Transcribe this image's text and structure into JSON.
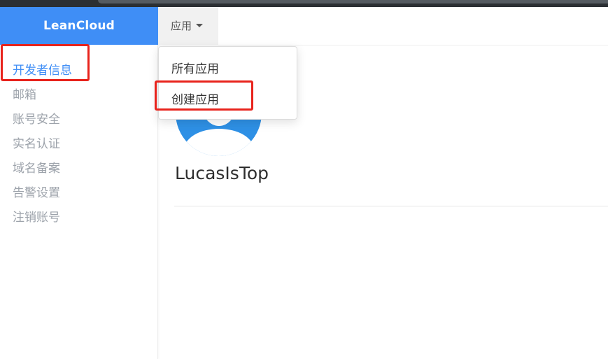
{
  "brand": {
    "name": "LeanCloud"
  },
  "topnav": {
    "dropdown_label": "应用"
  },
  "sidebar": {
    "items": [
      {
        "label": "开发者信息",
        "active": true
      },
      {
        "label": "邮箱"
      },
      {
        "label": "账号安全"
      },
      {
        "label": "实名认证"
      },
      {
        "label": "域名备案"
      },
      {
        "label": "告警设置"
      },
      {
        "label": "注销账号"
      }
    ]
  },
  "dropdown_menu": {
    "items": [
      {
        "label": "所有应用"
      },
      {
        "label": "创建应用"
      }
    ]
  },
  "profile": {
    "username": "LucasIsTop"
  },
  "colors": {
    "brand": "#3f8ef6",
    "avatar": "#2e90e5",
    "annotation": "#e8231c"
  }
}
